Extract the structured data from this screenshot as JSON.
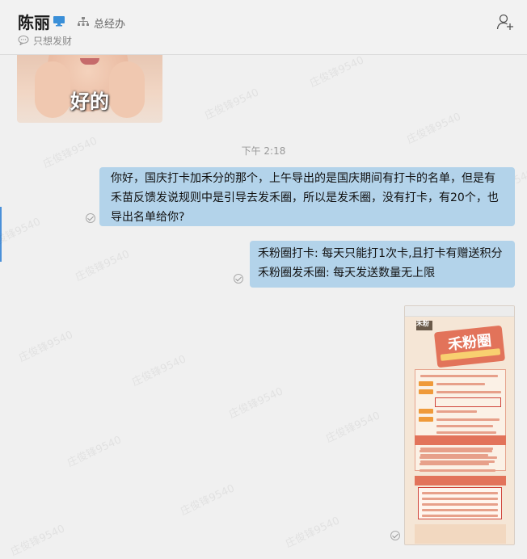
{
  "header": {
    "contact_name": "陈丽",
    "department": "总经办",
    "signature": "只想发财",
    "icons": {
      "device": "desktop-online-icon",
      "org": "org-chart-icon",
      "signature": "speech-bubble-icon",
      "add": "add-user-icon"
    }
  },
  "chat": {
    "sticker_text": "好的",
    "timestamp": "下午 2:18",
    "message1": "你好，国庆打卡加禾分的那个，上午导出的是国庆期间有打卡的名单，但是有禾苗反馈发说规则中是引导去发禾圈，所以是发禾圈，没有打卡，有20个，也导出名单给你?",
    "message2_lines": [
      "禾粉圈打卡: 每天只能打1次卡,且打卡有赠送积分",
      "禾粉圈发禾圈: 每天发送数量无上限"
    ],
    "poster_title": "禾粉圈",
    "poster_logo": "禾粉",
    "watermark": "庄俊锋9540"
  },
  "colors": {
    "bubble": "#b3d3ea",
    "background": "#f0f0f0",
    "accent": "#4a90d9"
  }
}
